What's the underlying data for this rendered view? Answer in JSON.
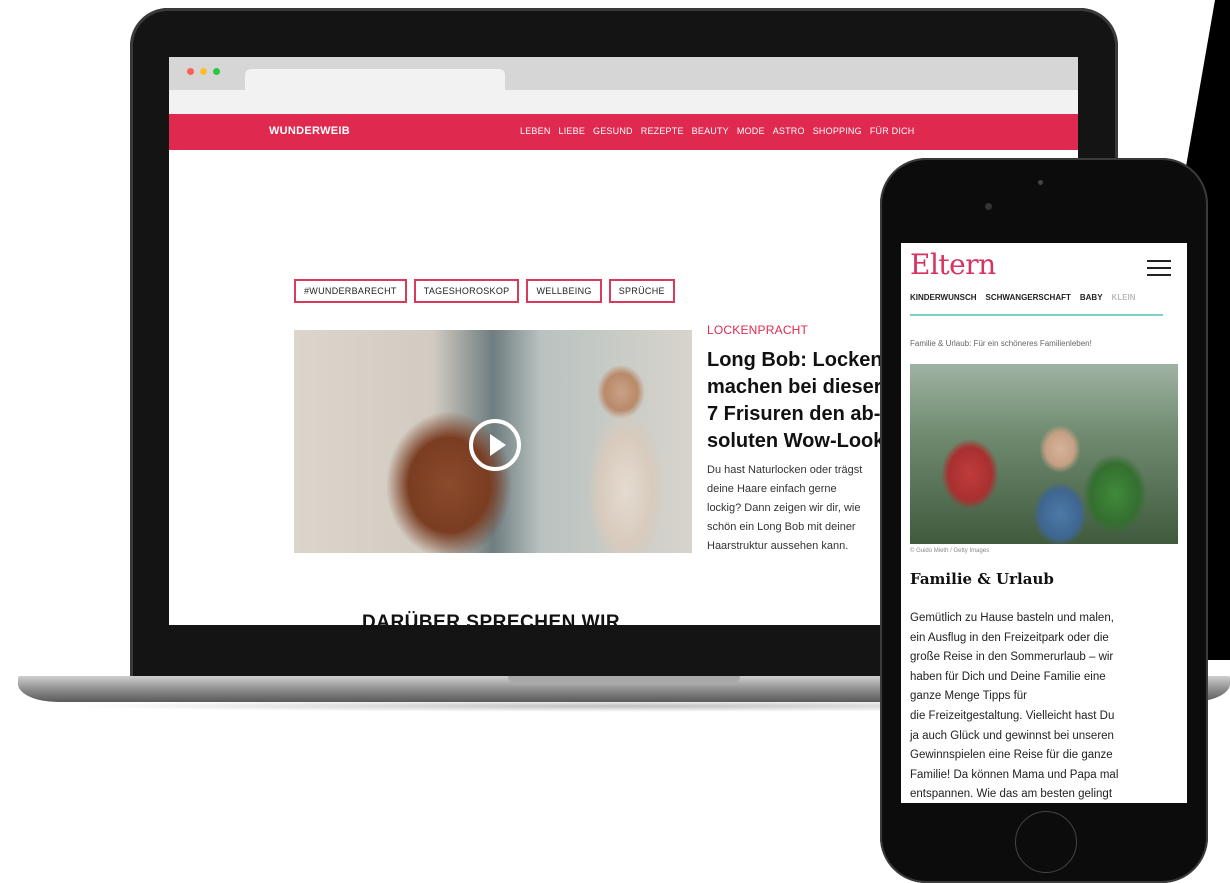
{
  "laptop": {
    "site": {
      "logo": "WUNDERWEIB",
      "nav": [
        "LEBEN",
        "LIEBE",
        "GESUND",
        "REZEPTE",
        "BEAUTY",
        "MODE",
        "ASTRO",
        "SHOPPING",
        "FÜR DICH"
      ]
    },
    "tags": [
      "#WUNDERBARECHT",
      "TAGESHOROSKOP",
      "WELLBEING",
      "SPRÜCHE"
    ],
    "article": {
      "kicker": "LOCKENPRACHT",
      "headline": "Long Bob: Locken\nmachen bei dieser\n7 Frisuren den ab-\nsoluten Wow-Look",
      "teaser": "Du hast Naturlocken oder trägst\ndeine Haare einfach gerne\nlockig? Dann zeigen wir dir, wie\nschön ein Long Bob mit deiner\nHaarstruktur aussehen kann."
    },
    "section_title": "DARÜBER SPRECHEN WIR"
  },
  "phone": {
    "logo": "Eltern",
    "nav": [
      "KINDERWUNSCH",
      "SCHWANGERSCHAFT",
      "BABY",
      "KLEIN"
    ],
    "breadcrumb": "Familie & Urlaub: Für ein schöneres Familienleben!",
    "image_caption": "© Guido Mieth / Getty Images",
    "title": "Familie & Urlaub",
    "body": "Gemütlich zu Hause basteln und malen,\nein Ausflug in den Freizeitpark oder die\ngroße Reise in den Sommerurlaub – wir\nhaben für Dich und Deine Familie eine\nganze Menge Tipps für\ndie Freizeitgestaltung. Vielleicht hast Du\nja auch Glück und gewinnst bei unseren\nGewinnspielen eine Reise für die ganze\nFamilie! Da können Mama und Papa mal\nentspannen. Wie das am besten gelingt"
  },
  "colors": {
    "brand_red": "#e0294f",
    "eltern_pink": "#d6335e",
    "eltern_divider": "#7cd3c5"
  }
}
